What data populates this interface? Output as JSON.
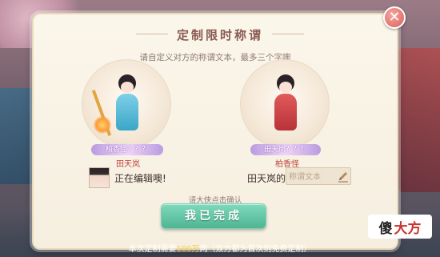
{
  "dialog": {
    "title": "定制限时称谓",
    "subtitle": "请自定义对方的称谓文本，最多三个字噢",
    "close_symbol": "✕"
  },
  "left_character": {
    "title_tag": "柏香怪？？？",
    "name": "田天岚"
  },
  "right_character": {
    "title_tag": "田天岚？？？",
    "name": "柏香怪"
  },
  "editing": {
    "status": "正在编辑噢!",
    "label": "田天岚的",
    "input_placeholder": "称谓文本",
    "input_value": ""
  },
  "hint": "请大侠点击确认",
  "done_button": "我已完成",
  "footer": {
    "prefix": "本次定制需要",
    "amount": "100万",
    "suffix": "两（双方都为首次则免费定制）"
  },
  "watermark": {
    "part1": "傻",
    "part2": "大方"
  },
  "colors": {
    "accent_green": "#4fb592",
    "name_red": "#c0453c",
    "gold": "#f7d24a"
  },
  "icons": [
    "close-icon",
    "pen-icon"
  ]
}
